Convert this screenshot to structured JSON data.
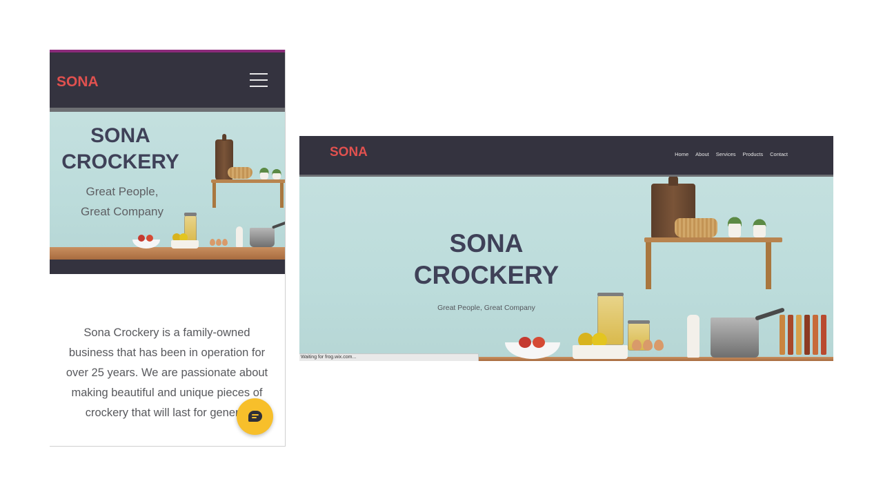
{
  "mobile": {
    "logo": "SONA",
    "menu_icon": "hamburger-menu-icon",
    "hero": {
      "title_line1": "SONA",
      "title_line2": "CROCKERY",
      "subtitle_line1": "Great People,",
      "subtitle_line2": "Great Company"
    },
    "about_lines": [
      "Sona Crockery is a family-owned",
      "business that has been in operation for",
      "over 25 years. We are passionate about",
      "making beautiful and unique pieces of",
      "crockery that will last for generat"
    ],
    "chat_icon": "chat-bubble-icon",
    "chat_color": "#f7bf2b"
  },
  "desktop": {
    "logo": "SONA",
    "nav": [
      "Home",
      "About",
      "Services",
      "Products",
      "Contact"
    ],
    "hero": {
      "title_line1": "SONA",
      "title_line2": "CROCKERY",
      "subtitle": "Great People, Great Company"
    },
    "status_text": "Waiting for frog.wix.com..."
  },
  "colors": {
    "header_bg": "#34333f",
    "logo_red": "#e0514f",
    "title": "#3f4158",
    "wall": "#c4e0df"
  }
}
